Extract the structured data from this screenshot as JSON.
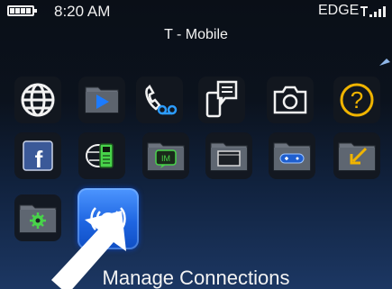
{
  "status_bar": {
    "time": "8:20 AM",
    "network": "EDGE",
    "battery_icon": "battery-full-icon",
    "signal_icon": "signal-strength-icon"
  },
  "carrier": "T - Mobile",
  "home_screen": {
    "rows": [
      [
        {
          "icon": "globe-icon"
        },
        {
          "icon": "media-play-icon"
        },
        {
          "icon": "phone-voicemail-icon"
        },
        {
          "icon": "messages-icon"
        },
        {
          "icon": "camera-icon"
        },
        {
          "icon": "help-icon"
        }
      ],
      [
        {
          "icon": "facebook-icon"
        },
        {
          "icon": "app-world-icon"
        },
        {
          "icon": "instant-messaging-folder-icon",
          "badge": "IM"
        },
        {
          "icon": "folder-icon"
        },
        {
          "icon": "games-folder-icon"
        },
        {
          "icon": "downloads-folder-icon"
        }
      ],
      [
        {
          "icon": "settings-folder-icon"
        },
        {
          "icon": "manage-connections-icon",
          "selected": true
        }
      ]
    ],
    "selected_label": "Manage Connections"
  },
  "colors": {
    "selected": "#2b76ee",
    "folder": "#5e6671",
    "accent_green": "#48d34a",
    "help": "#f0b400",
    "media": "#1c7bff",
    "facebook": "#3b5998"
  }
}
